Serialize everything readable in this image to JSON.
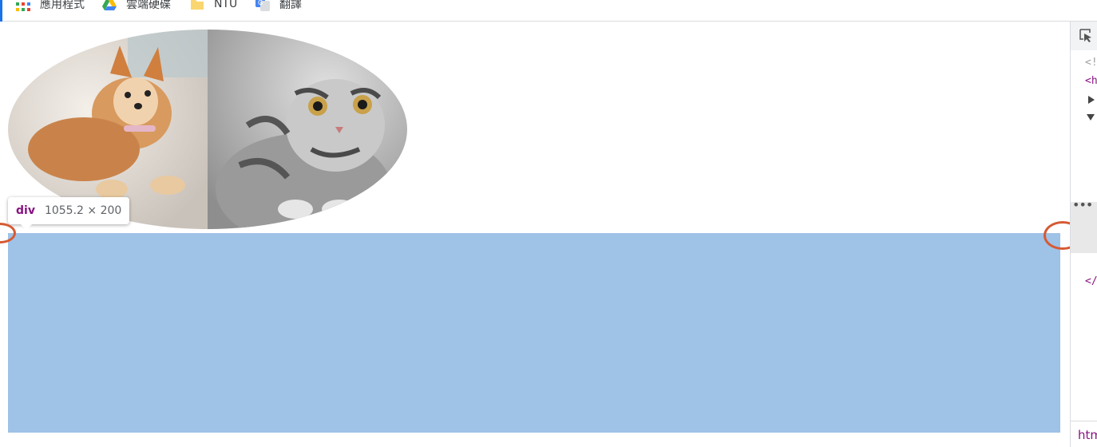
{
  "bookmarks": [
    {
      "label": "應用程式",
      "icon": "apps-grid-icon"
    },
    {
      "label": "雲端硬碟",
      "icon": "google-drive-icon"
    },
    {
      "label": "NTU",
      "icon": "folder-icon"
    },
    {
      "label": "翻譯",
      "icon": "google-translate-icon"
    }
  ],
  "tooltip": {
    "tag": "div",
    "dimensions": "1055.2 × 200"
  },
  "devtools": {
    "lines": [
      "<!",
      "<h",
      "</"
    ],
    "more_label": "•••",
    "breadcrumb": "htm"
  },
  "colors": {
    "highlight": "#9fc2e7",
    "tag": "#881280",
    "marker": "#d65a34"
  }
}
